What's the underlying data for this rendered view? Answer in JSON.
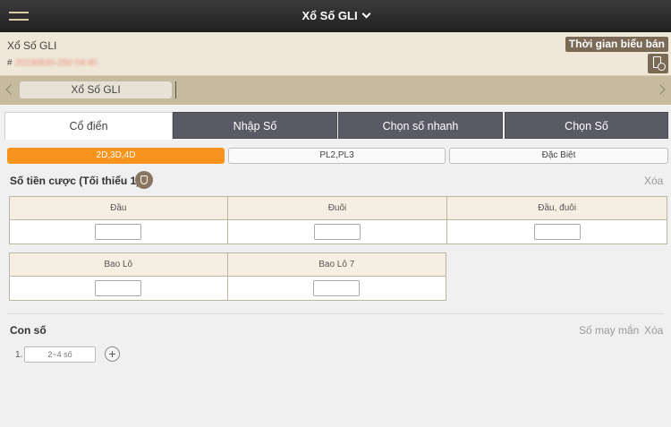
{
  "header": {
    "title": "Xổ Số GLI"
  },
  "info": {
    "game_name": "Xổ Số GLI",
    "draw_prefix": "#",
    "draw_number": "20230830-250 04:40",
    "schedule_button": "Thời gian biểu bán"
  },
  "game_tabs": [
    {
      "label": "Xổ Số GLI"
    }
  ],
  "mode_tabs": [
    {
      "label": "Cổ điển",
      "active": true
    },
    {
      "label": "Nhập Số",
      "active": false
    },
    {
      "label": "Chọn số nhanh",
      "active": false
    },
    {
      "label": "Chọn Số",
      "active": false
    }
  ],
  "sub_tabs": [
    {
      "label": "2D,3D,4D",
      "active": true
    },
    {
      "label": "PL2,PL3",
      "active": false
    },
    {
      "label": "Đặc Biệt",
      "active": false
    }
  ],
  "amount": {
    "label": "Số tiền cược (Tối thiểu 1)",
    "clear": "Xóa",
    "row1": [
      "Đầu",
      "Đuôi",
      "Đầu, đuôi"
    ],
    "row2": [
      "Bao Lô",
      "Bao Lô 7"
    ]
  },
  "numbers": {
    "label": "Con số",
    "lucky": "Số may mắn",
    "clear": "Xóa",
    "index": "1.",
    "placeholder": "2~4 số"
  },
  "colors": {
    "accent": "#f7941d",
    "brand": "#7b6a55",
    "tab_inactive": "#5a5a66"
  }
}
